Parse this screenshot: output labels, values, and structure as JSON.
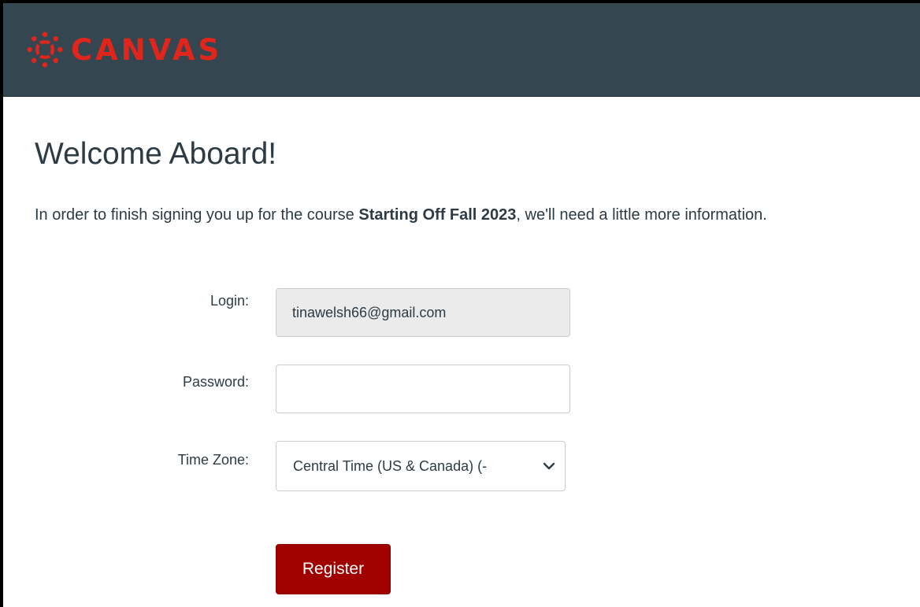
{
  "header": {
    "brand_name": "CANVAS",
    "logo_icon": "canvas-logo-icon",
    "bg_color": "#344650",
    "brand_color": "#e0251b"
  },
  "main": {
    "title": "Welcome Aboard!",
    "intro_before": "In order to finish signing you up for the course ",
    "course_name": "Starting Off Fall 2023",
    "intro_after": ", we'll need a little more information."
  },
  "form": {
    "login_label": "Login:",
    "login_value": "tinawelsh66@gmail.com",
    "password_label": "Password:",
    "password_value": "",
    "timezone_label": "Time Zone:",
    "timezone_value": "Central Time (US & Canada) (-",
    "register_label": "Register",
    "register_color": "#a00000"
  }
}
